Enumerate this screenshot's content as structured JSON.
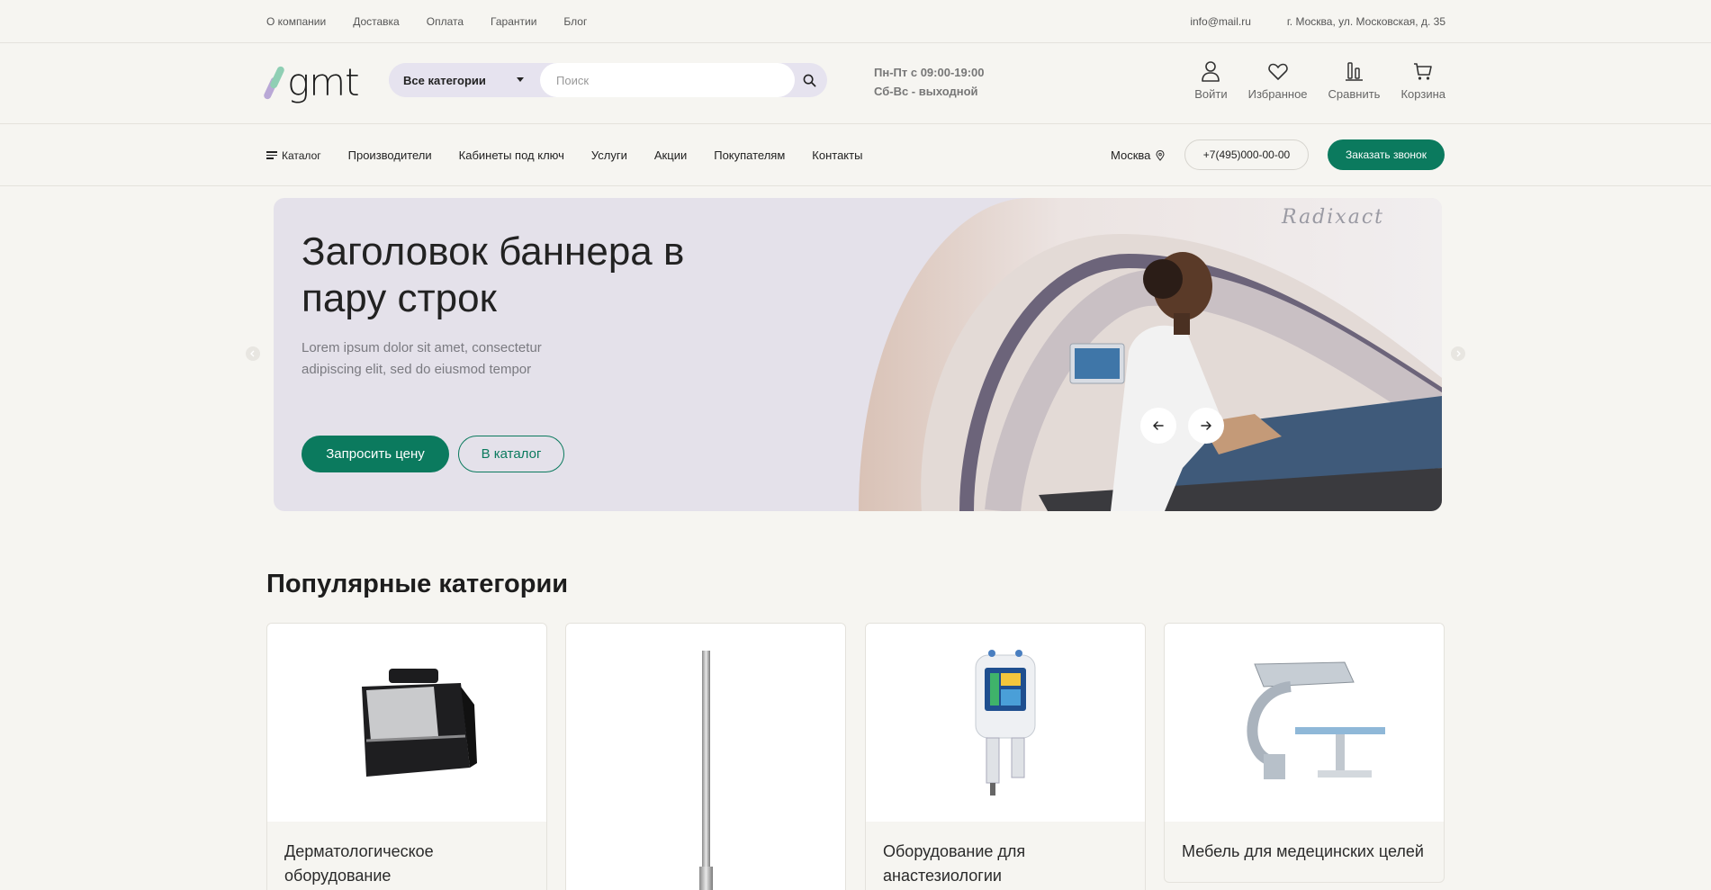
{
  "topbar": {
    "links": [
      "О компании",
      "Доставка",
      "Оплата",
      "Гарантии",
      "Блог"
    ],
    "email": "info@mail.ru",
    "address": "г. Москва, ул. Московская, д. 35"
  },
  "header": {
    "logo_text": "gmt",
    "search": {
      "category_label": "Все категории",
      "placeholder": "Поиск"
    },
    "hours_line1": "Пн-Пт с 09:00-19:00",
    "hours_line2": "Сб-Вс - выходной",
    "icons": {
      "login": "Войти",
      "favorites": "Избранное",
      "compare": "Сравнить",
      "cart": "Корзина"
    }
  },
  "nav": {
    "catalog": "Каталог",
    "items": [
      "Производители",
      "Кабинеты под ключ",
      "Услуги",
      "Акции",
      "Покупателям",
      "Контакты"
    ],
    "city": "Москва",
    "phone": "+7(495)000-00-00",
    "call_button": "Заказать звонок"
  },
  "banner": {
    "title": "Заголовок баннера в пару строк",
    "description": "Lorem ipsum dolor sit amet, consectetur adipiscing elit, sed do eiusmod tempor",
    "button_primary": "Запросить цену",
    "button_secondary": "В каталог",
    "photo_brand": "Radixact"
  },
  "categories": {
    "title": "Популярные категории",
    "items": [
      {
        "name": "Дерматологическое оборудование"
      },
      {
        "name": ""
      },
      {
        "name": "Оборудование для анастезиологии"
      },
      {
        "name": "Мебель для медецинских целей"
      }
    ]
  },
  "colors": {
    "accent": "#0b7a5e",
    "banner_bg": "#e4e1ea",
    "page_bg": "#f6f5f1"
  }
}
